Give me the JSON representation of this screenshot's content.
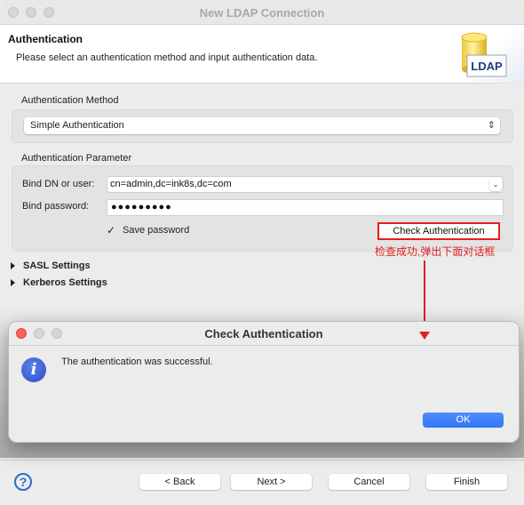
{
  "window": {
    "title": "New LDAP Connection"
  },
  "banner": {
    "title": "Authentication",
    "description": "Please select an authentication method and input authentication data.",
    "icon_label": "LDAP",
    "icon": "ldap-database-icon"
  },
  "auth_method": {
    "section_label": "Authentication Method",
    "selected": "Simple Authentication",
    "select_arrow": "⌃⌄"
  },
  "auth_params": {
    "section_label": "Authentication Parameter",
    "bind_dn_label": "Bind DN or user:",
    "bind_dn_value": "cn=admin,dc=ink8s,dc=com",
    "bind_password_label": "Bind password:",
    "bind_password_value": "●●●●●●●●●",
    "save_password_label": "Save password",
    "save_password_checked": true,
    "check_mark": "✓",
    "check_auth_button": "Check Authentication"
  },
  "annotation": {
    "text": "检查成功,弹出下面对话框",
    "color": "#e02020"
  },
  "expanders": [
    {
      "label": "SASL Settings",
      "expanded": false
    },
    {
      "label": "Kerberos Settings",
      "expanded": false
    }
  ],
  "dialog": {
    "title": "Check Authentication",
    "icon": "info-icon",
    "icon_glyph": "i",
    "message": "The authentication was successful.",
    "ok_label": "OK"
  },
  "footer": {
    "help_glyph": "?",
    "back_label": "< Back",
    "next_label": "Next >",
    "cancel_label": "Cancel",
    "finish_label": "Finish"
  }
}
